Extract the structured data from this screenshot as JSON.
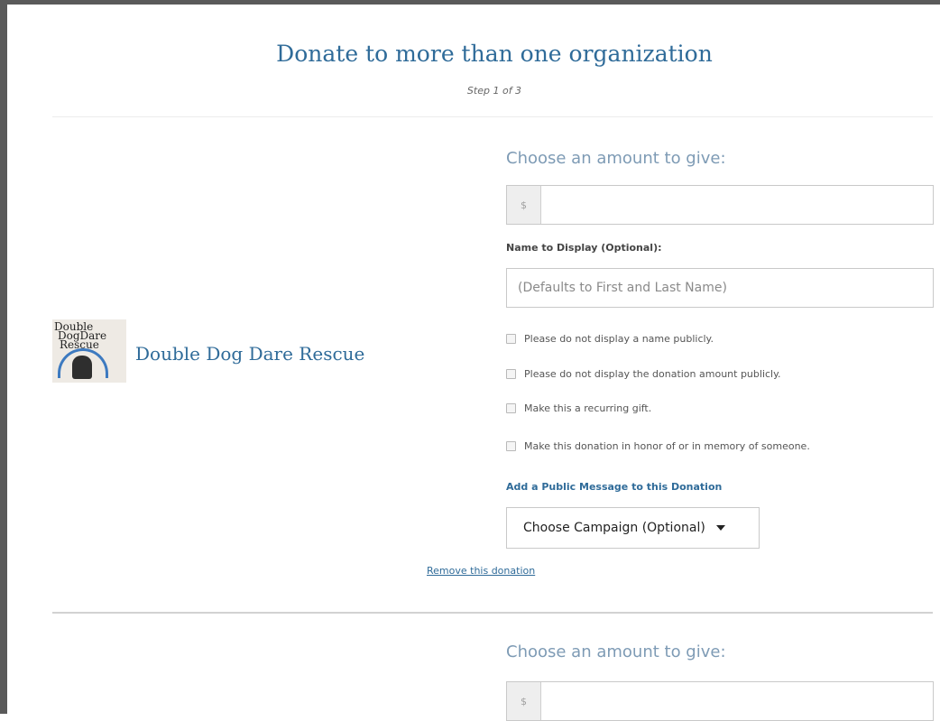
{
  "header": {
    "title": "Donate to more than one organization",
    "step": "Step 1 of 3"
  },
  "donations": [
    {
      "org": {
        "name": "Double Dog Dare Rescue",
        "logo_text": [
          "Double",
          "DogDare",
          "Rescue"
        ]
      },
      "choose_heading": "Choose an amount to give:",
      "currency_symbol": "$",
      "amount_value": "",
      "name_label": "Name to Display (Optional):",
      "name_placeholder": "(Defaults to First and Last Name)",
      "options": [
        "Please do not display a name publicly.",
        "Please do not display the donation amount publicly.",
        "Make this a recurring gift.",
        "Make this donation in honor of or in memory of someone."
      ],
      "public_message_link": "Add a Public Message to this Donation",
      "campaign_select": "Choose Campaign (Optional)",
      "remove_link": "Remove this donation"
    },
    {
      "choose_heading": "Choose an amount to give:",
      "currency_symbol": "$",
      "amount_value": ""
    }
  ]
}
